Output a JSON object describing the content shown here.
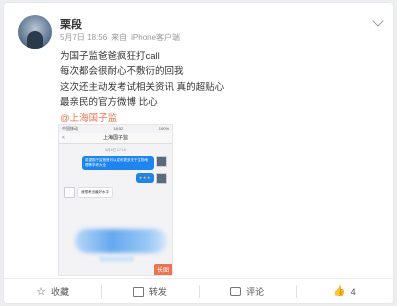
{
  "post": {
    "username": "栗段",
    "date": "5月7日 18:56",
    "source_prefix": "来自",
    "source": "iPhone客户端",
    "lines": [
      "为国子监爸爸疯狂打call",
      "每次都会很耐心不敷衍的回我",
      "这次还主动发考试相关资讯 真的超贴心",
      "最亲民的官方微博 比心"
    ],
    "link": "@上海国子监"
  },
  "screenshot": {
    "carrier": "中国移动",
    "time": "18:52",
    "battery": "100%",
    "back": "<",
    "title": "上海国子监",
    "msg_time": "5月6日 17:15",
    "msg1": "希望国子监爸爸可以发布更多关于生物地理等学考大全",
    "msg_stars": "★★★",
    "msg2": "我想考出最好水平",
    "badge": "长图"
  },
  "footer": {
    "favorite_label": "收藏",
    "share_label": "转发",
    "comment_label": "评论",
    "like_count": "4"
  }
}
